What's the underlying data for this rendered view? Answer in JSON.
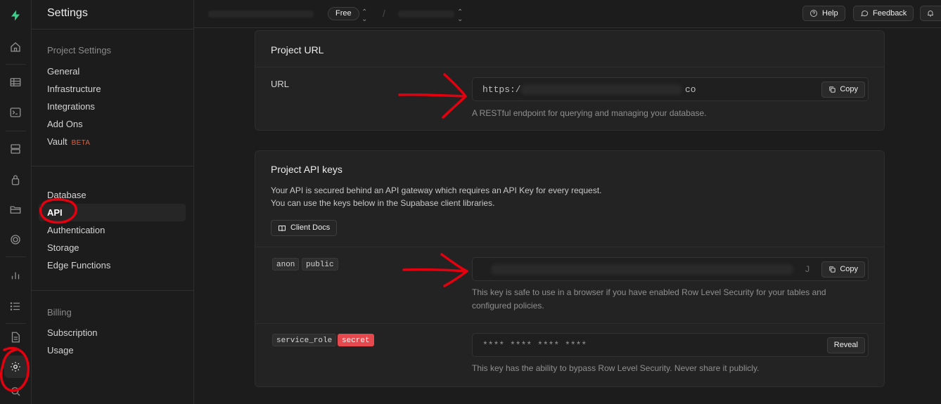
{
  "sidebar": {
    "title": "Settings",
    "sections": [
      {
        "heading": "Project Settings",
        "items": [
          {
            "label": "General"
          },
          {
            "label": "Infrastructure"
          },
          {
            "label": "Integrations"
          },
          {
            "label": "Add Ons"
          },
          {
            "label": "Vault",
            "badge": "BETA"
          }
        ]
      },
      {
        "heading": "",
        "items": [
          {
            "label": "Database"
          },
          {
            "label": "API",
            "active": true
          },
          {
            "label": "Authentication"
          },
          {
            "label": "Storage"
          },
          {
            "label": "Edge Functions"
          }
        ]
      },
      {
        "heading": "Billing",
        "items": [
          {
            "label": "Subscription"
          },
          {
            "label": "Usage"
          }
        ]
      }
    ]
  },
  "rail": {
    "icons": [
      "supabase-logo-icon",
      "home-icon",
      "table-editor-icon",
      "sql-editor-icon",
      "database-icon",
      "auth-icon",
      "storage-icon",
      "realtime-icon",
      "reports-icon",
      "logs-icon",
      "docs-icon",
      "settings-icon",
      "search-icon"
    ],
    "colors": {
      "logo": "#3ecf8e",
      "annotation": "#e3000f"
    }
  },
  "topbar": {
    "plan": "Free",
    "separator": "/",
    "help_label": "Help",
    "feedback_label": "Feedback"
  },
  "project_url": {
    "title": "Project URL",
    "row_label": "URL",
    "value_start": "https:/",
    "value_end": "co",
    "copy_label": "Copy",
    "hint": "A RESTful endpoint for querying and managing your database."
  },
  "api_keys": {
    "title": "Project API keys",
    "desc_line1": "Your API is secured behind an API gateway which requires an API Key for every request.",
    "desc_line2": "You can use the keys below in the Supabase client libraries.",
    "docs_label": "Client Docs",
    "anon": {
      "tag1": "anon",
      "tag2": "public",
      "value_end": "J",
      "copy_label": "Copy",
      "hint": "This key is safe to use in a browser if you have enabled Row Level Security for your tables and configured policies."
    },
    "service": {
      "tag1": "service_role",
      "tag2": "secret",
      "value": "**** **** **** ****",
      "reveal_label": "Reveal",
      "hint": "This key has the ability to bypass Row Level Security. Never share it publicly."
    }
  }
}
